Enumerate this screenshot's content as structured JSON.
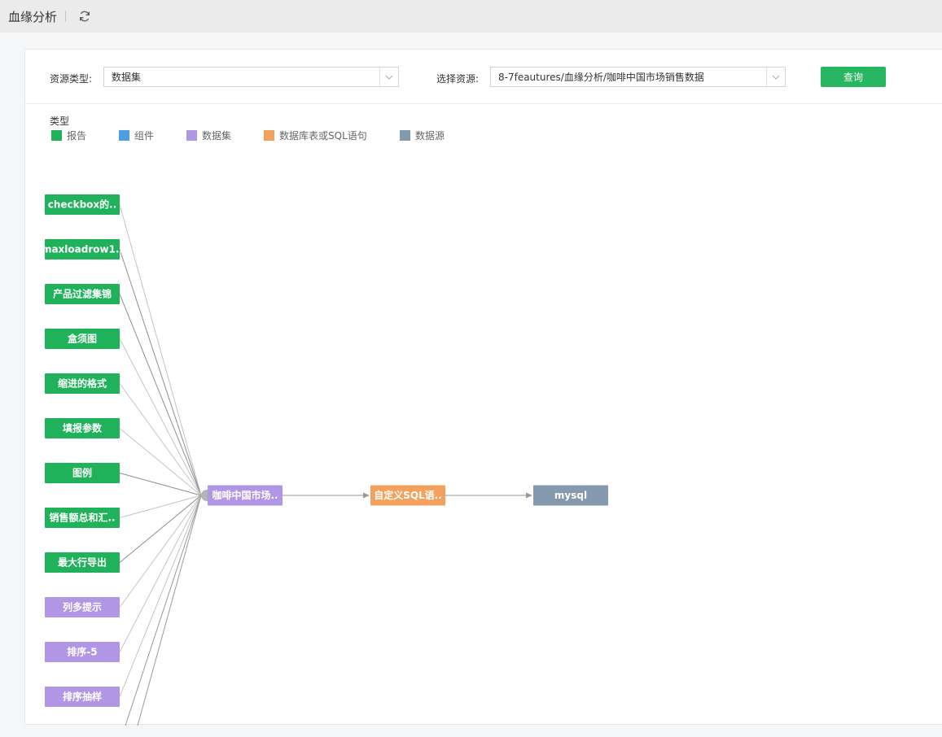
{
  "header": {
    "title": "血缘分析",
    "refresh_icon": "refresh-icon"
  },
  "filters": {
    "resource_type_label": "资源类型:",
    "resource_type_value": "数据集",
    "select_resource_label": "选择资源:",
    "select_resource_value": "8-7feautures/血缘分析/咖啡中国市场销售数据",
    "query_label": "查询"
  },
  "legend": {
    "title": "类型",
    "items": [
      {
        "label": "报告",
        "color": "#1fb25a"
      },
      {
        "label": "组件",
        "color": "#4b9ee2"
      },
      {
        "label": "数据集",
        "color": "#b196e6"
      },
      {
        "label": "数据库表或SQL语句",
        "color": "#f4a15d"
      },
      {
        "label": "数据源",
        "color": "#8599ae"
      }
    ]
  },
  "graph": {
    "sources": [
      {
        "label": "checkbox的..",
        "kind": "报告"
      },
      {
        "label": "maxloadrow1..",
        "kind": "报告"
      },
      {
        "label": "产品过滤集锦",
        "kind": "报告"
      },
      {
        "label": "盒须图",
        "kind": "报告"
      },
      {
        "label": "缩进的格式",
        "kind": "报告"
      },
      {
        "label": "填报参数",
        "kind": "报告"
      },
      {
        "label": "图例",
        "kind": "报告"
      },
      {
        "label": "销售额总和汇..",
        "kind": "报告"
      },
      {
        "label": "最大行导出",
        "kind": "报告"
      },
      {
        "label": "列多提示",
        "kind": "数据集"
      },
      {
        "label": "排序-5",
        "kind": "数据集"
      },
      {
        "label": "排序抽样",
        "kind": "数据集"
      }
    ],
    "chain": [
      {
        "label": "咖啡中国市场..",
        "kind": "数据集"
      },
      {
        "label": "自定义SQL语..",
        "kind": "数据库表或SQL语句"
      },
      {
        "label": "mysql",
        "kind": "数据源"
      }
    ]
  }
}
